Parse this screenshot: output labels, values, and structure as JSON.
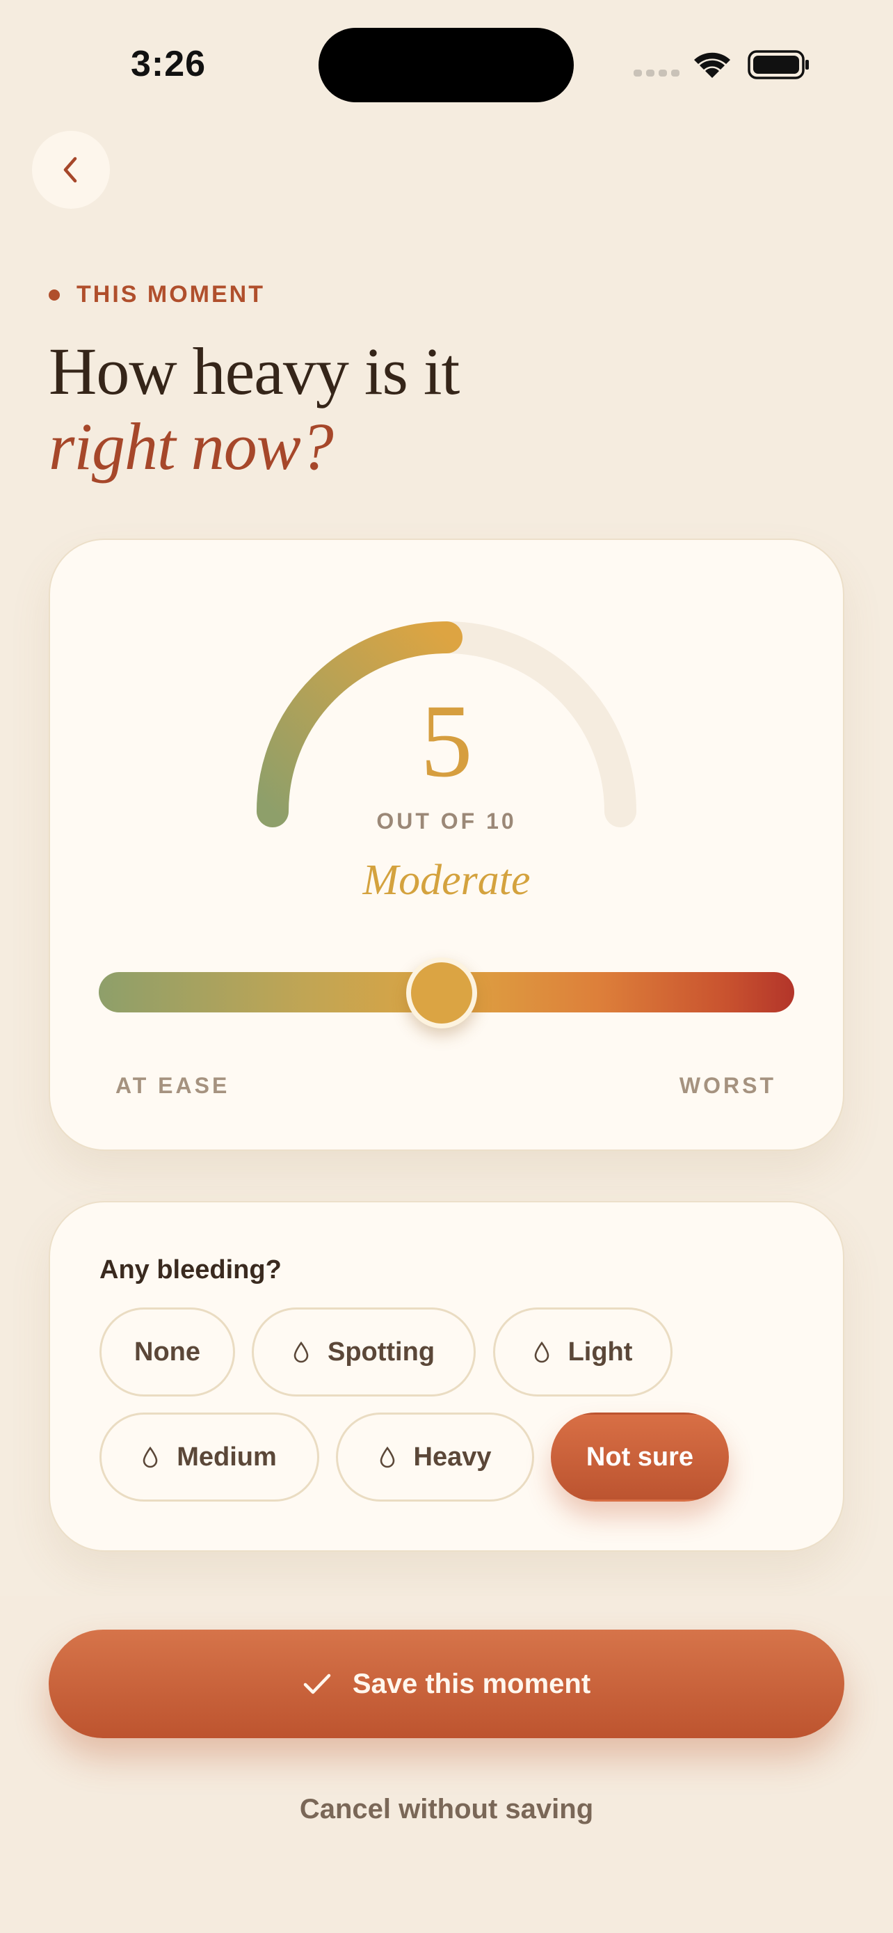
{
  "status_bar": {
    "time": "3:26"
  },
  "header": {
    "eyebrow": "THIS MOMENT",
    "title_line1": "How heavy is it",
    "title_line2": "right now?"
  },
  "intensity": {
    "value": 5,
    "value_text": "5",
    "out_of": "OUT OF 10",
    "max": 10,
    "level_label": "Moderate",
    "scale_min_label": "AT EASE",
    "scale_max_label": "WORST"
  },
  "bleeding": {
    "question": "Any bleeding?",
    "options": [
      {
        "label": "None",
        "icon": "",
        "selected": false
      },
      {
        "label": "Spotting",
        "icon": "drop-icon",
        "selected": false
      },
      {
        "label": "Light",
        "icon": "drop-icon",
        "selected": false
      },
      {
        "label": "Medium",
        "icon": "drop-icon",
        "selected": false
      },
      {
        "label": "Heavy",
        "icon": "drop-icon",
        "selected": false
      },
      {
        "label": "Not sure",
        "icon": "",
        "selected": true
      }
    ]
  },
  "actions": {
    "save_label": "Save this moment",
    "cancel_label": "Cancel without saving"
  },
  "colors": {
    "background": "#f5ecdf",
    "accent": "#c35c34",
    "gauge_active": "#d69e3f",
    "gauge_start": "#8e9f6a"
  }
}
